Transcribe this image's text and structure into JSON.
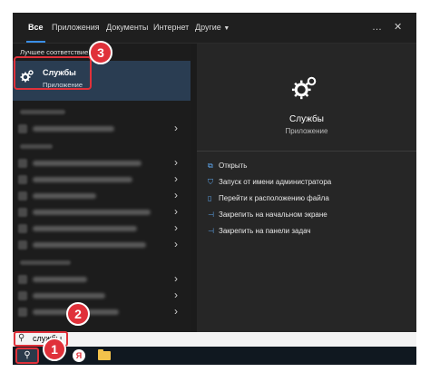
{
  "tabs": {
    "all": "Все",
    "apps": "Приложения",
    "docs": "Документы",
    "web": "Интернет",
    "more": "Другие",
    "more_icon": "chevron-down-icon"
  },
  "top_icons": {
    "ellipsis": "…",
    "close": "✕"
  },
  "left": {
    "best_match_label": "Лучшее соответствие",
    "best": {
      "title": "Службы",
      "subtitle": "Приложение",
      "icon": "gears-icon"
    },
    "blurred_rows": 10
  },
  "right": {
    "app_name": "Службы",
    "app_kind": "Приложение",
    "actions": [
      {
        "label": "Открыть",
        "icon": "open-icon"
      },
      {
        "label": "Запуск от имени администратора",
        "icon": "shield-icon"
      },
      {
        "label": "Перейти к расположению файла",
        "icon": "file-icon"
      },
      {
        "label": "Закрепить на начальном экране",
        "icon": "pin-icon"
      },
      {
        "label": "Закрепить на панели задач",
        "icon": "pin-icon"
      }
    ]
  },
  "search": {
    "value": "службы",
    "icon": "search-icon"
  },
  "taskbar": {
    "yandex_letter": "Я"
  },
  "callouts": {
    "one": "1",
    "two": "2",
    "three": "3"
  },
  "colors": {
    "highlight": "#e0313a",
    "selection": "#2a3d52",
    "accent": "#3a8ee6"
  }
}
